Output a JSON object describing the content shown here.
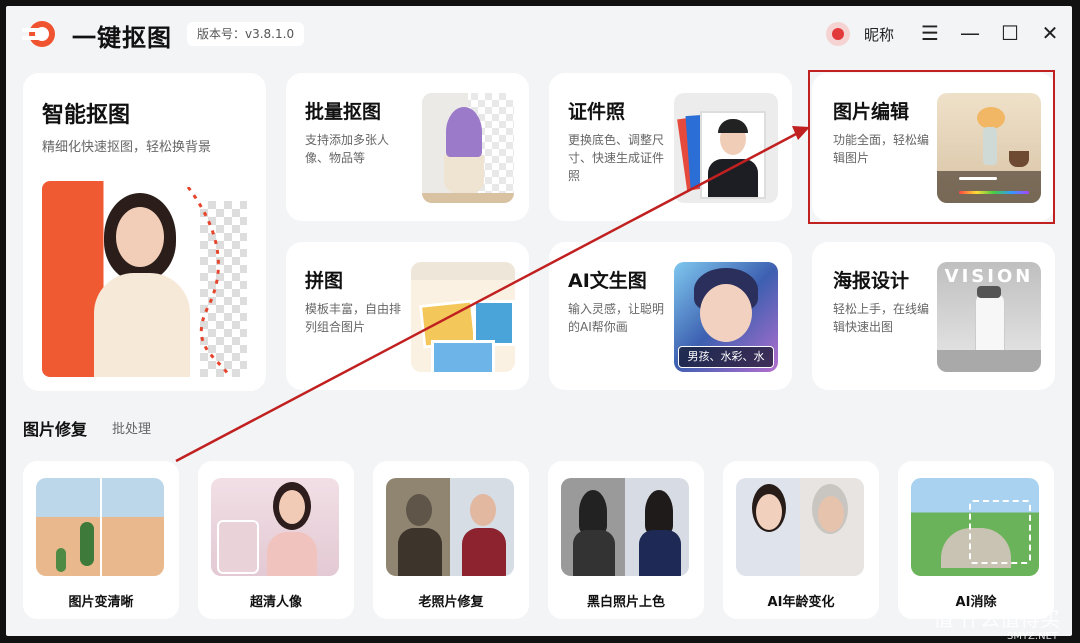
{
  "app": {
    "name": "一键抠图",
    "version": "版本号：v3.8.1.0",
    "nickname": "昵称"
  },
  "window_controls": {
    "menu": "☰",
    "minimize": "—",
    "maximize": "☐",
    "close": "✕"
  },
  "main_card": {
    "title": "智能抠图",
    "desc": "精细化快速抠图，轻松换背景"
  },
  "cards": [
    {
      "title": "批量抠图",
      "desc": "支持添加多张人像、物品等"
    },
    {
      "title": "证件照",
      "desc": "更换底色、调整尺寸、快速生成证件照"
    },
    {
      "title": "图片编辑",
      "desc": "功能全面，轻松编辑图片"
    },
    {
      "title": "拼图",
      "desc": "模板丰富，自由排列组合图片"
    },
    {
      "title": "AI文生图",
      "desc": "输入灵感，让聪明的AI帮你画",
      "tag": "男孩、水彩、水"
    },
    {
      "title": "海报设计",
      "desc": "轻松上手，在线编辑快速出图",
      "poster_text": "VISION"
    }
  ],
  "section": {
    "title": "图片修复",
    "subtitle": "批处理"
  },
  "tools": [
    {
      "label": "图片变清晰"
    },
    {
      "label": "超清人像"
    },
    {
      "label": "老照片修复"
    },
    {
      "label": "黑白照片上色"
    },
    {
      "label": "AI年龄变化"
    },
    {
      "label": "AI消除"
    }
  ],
  "watermark": {
    "big": "值 什么值得买",
    "small": "SMYZ.NET"
  },
  "colors": {
    "accent": "#f0532f",
    "highlight": "#c0201f",
    "background": "#f3f4f6"
  },
  "icons": [
    "logo-icon",
    "avatar-icon",
    "menu-icon",
    "minimize-icon",
    "maximize-icon",
    "close-icon"
  ]
}
